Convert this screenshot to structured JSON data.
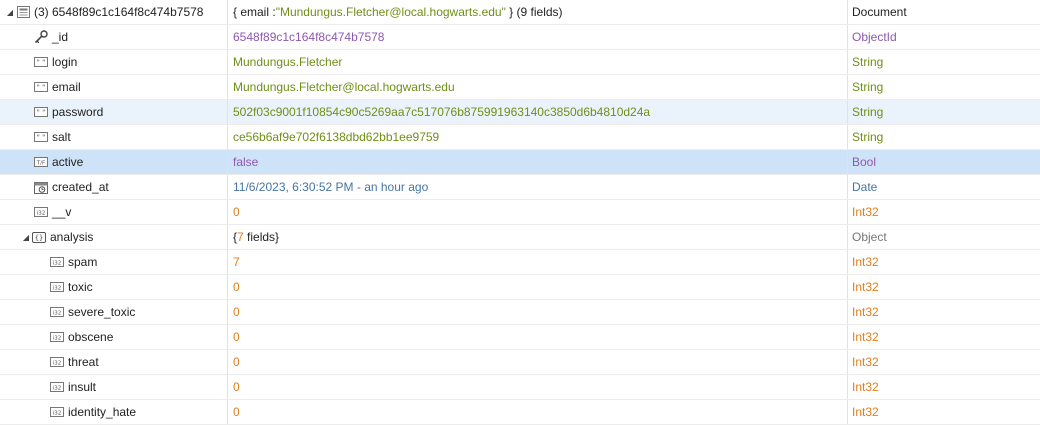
{
  "document": {
    "key": "(3) 6548f89c1c164f8c474b7578",
    "summary_prefix": "{ email : ",
    "summary_value": "\"Mundungus.Fletcher@local.hogwarts.edu\"",
    "summary_suffix": " } (9 fields)",
    "type": "Document",
    "icon": "document-icon"
  },
  "fields": [
    {
      "key": "_id",
      "value": "6548f89c1c164f8c474b7578",
      "type": "ObjectId",
      "icon": "key-icon"
    },
    {
      "key": "login",
      "value": "Mundungus.Fletcher",
      "type": "String",
      "icon": "string-icon"
    },
    {
      "key": "email",
      "value": "Mundungus.Fletcher@local.hogwarts.edu",
      "type": "String",
      "icon": "string-icon"
    },
    {
      "key": "password",
      "value": "502f03c9001f10854c90c5269aa7c517076b875991963140c3850d6b4810d24a",
      "type": "String",
      "icon": "string-icon"
    },
    {
      "key": "salt",
      "value": "ce56b6af9e702f6138dbd62bb1ee9759",
      "type": "String",
      "icon": "string-icon"
    },
    {
      "key": "active",
      "value": "false",
      "type": "Bool",
      "icon": "bool-icon"
    },
    {
      "key": "created_at",
      "value": "11/6/2023, 6:30:52 PM - an hour ago",
      "type": "Date",
      "icon": "date-icon"
    },
    {
      "key": "__v",
      "value": "0",
      "type": "Int32",
      "icon": "int32-icon"
    }
  ],
  "analysis": {
    "key": "analysis",
    "summary_open": "{",
    "summary_count": "7",
    "summary_close": " fields}",
    "type": "Object",
    "icon": "object-icon",
    "fields": [
      {
        "key": "spam",
        "value": "7",
        "type": "Int32"
      },
      {
        "key": "toxic",
        "value": "0",
        "type": "Int32"
      },
      {
        "key": "severe_toxic",
        "value": "0",
        "type": "Int32"
      },
      {
        "key": "obscene",
        "value": "0",
        "type": "Int32"
      },
      {
        "key": "threat",
        "value": "0",
        "type": "Int32"
      },
      {
        "key": "insult",
        "value": "0",
        "type": "Int32"
      },
      {
        "key": "identity_hate",
        "value": "0",
        "type": "Int32"
      }
    ]
  },
  "colors": {
    "string": "#6f8f16",
    "number": "#e07f1d",
    "objectid_bool": "#8e58b0",
    "date": "#4775a6",
    "selected_row": "#cfe3f8",
    "hover_row": "#eaf2fb"
  }
}
